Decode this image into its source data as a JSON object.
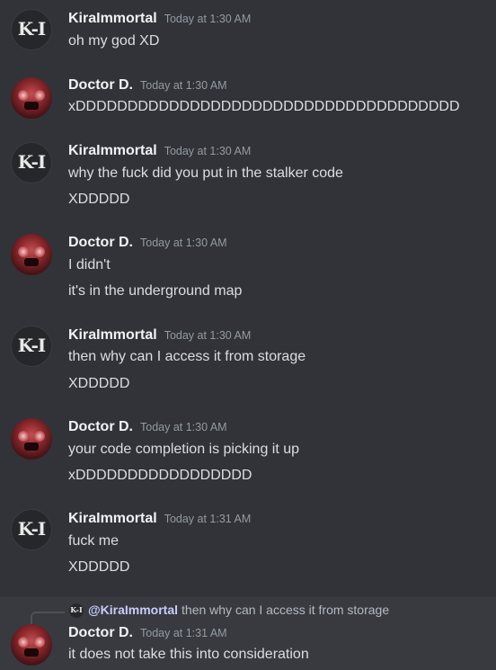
{
  "users": {
    "kira": {
      "name": "KiraImmortal",
      "avatar_text": "K-I"
    },
    "doctor": {
      "name": "Doctor D."
    }
  },
  "messages": [
    {
      "author": "KiraImmortal",
      "time": "Today at 1:30 AM",
      "lines": [
        "oh my god XD"
      ]
    },
    {
      "author": "Doctor D.",
      "time": "Today at 1:30 AM",
      "lines": [
        "xDDDDDDDDDDDDDDDDDDDDDDDDDDDDDDDDDDDDD"
      ]
    },
    {
      "author": "KiraImmortal",
      "time": "Today at 1:30 AM",
      "lines": [
        "why the fuck did you put in the stalker code",
        "XDDDDD"
      ]
    },
    {
      "author": "Doctor D.",
      "time": "Today at 1:30 AM",
      "lines": [
        "I didn't",
        "it's in the underground map"
      ]
    },
    {
      "author": "KiraImmortal",
      "time": "Today at 1:30 AM",
      "lines": [
        "then why can I access it from storage",
        "XDDDDD"
      ]
    },
    {
      "author": "Doctor D.",
      "time": "Today at 1:30 AM",
      "lines": [
        "your code completion is picking it up",
        "xDDDDDDDDDDDDDDDDD"
      ]
    },
    {
      "author": "KiraImmortal",
      "time": "Today at 1:31 AM",
      "lines": [
        "fuck me",
        "XDDDDD"
      ]
    },
    {
      "author": "Doctor D.",
      "time": "Today at 1:31 AM",
      "lines": [
        "it does not take this into consideration"
      ]
    }
  ],
  "reply": {
    "mention": "@KiraImmortal",
    "text": "then why can I access it from storage"
  }
}
